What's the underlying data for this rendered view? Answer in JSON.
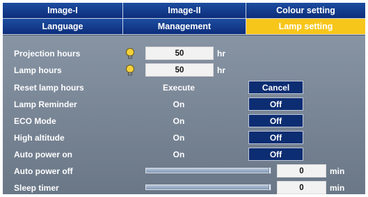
{
  "tabs_row1": [
    "Image-I",
    "Image-II",
    "Colour setting"
  ],
  "tabs_row2": [
    "Language",
    "Management",
    "Lamp setting"
  ],
  "active_tab": "Lamp setting",
  "colors": {
    "tab_bg": "#0d2d7a",
    "active_tab": "#f7c61b",
    "panel": "#7a8797",
    "button": "#0d2d72"
  },
  "rows": {
    "projection_hours": {
      "label": "Projection hours",
      "value": "50",
      "unit": "hr",
      "icon": "lamp-bulb-icon"
    },
    "lamp_hours": {
      "label": "Lamp hours",
      "value": "50",
      "unit": "hr",
      "icon": "lamp-bulb-icon"
    },
    "reset_lamp_hours": {
      "label": "Reset lamp hours",
      "option": "Execute",
      "button": "Cancel"
    },
    "lamp_reminder": {
      "label": "Lamp Reminder",
      "option": "On",
      "button": "Off"
    },
    "eco_mode": {
      "label": "ECO Mode",
      "option": "On",
      "button": "Off"
    },
    "high_altitude": {
      "label": "High altitude",
      "option": "On",
      "button": "Off"
    },
    "auto_power_on": {
      "label": "Auto power on",
      "option": "On",
      "button": "Off"
    },
    "auto_power_off": {
      "label": "Auto power off",
      "value": "0",
      "unit": "min",
      "slider_fraction": 1.0
    },
    "sleep_timer": {
      "label": "Sleep timer",
      "value": "0",
      "unit": "min",
      "slider_fraction": 1.0
    }
  }
}
